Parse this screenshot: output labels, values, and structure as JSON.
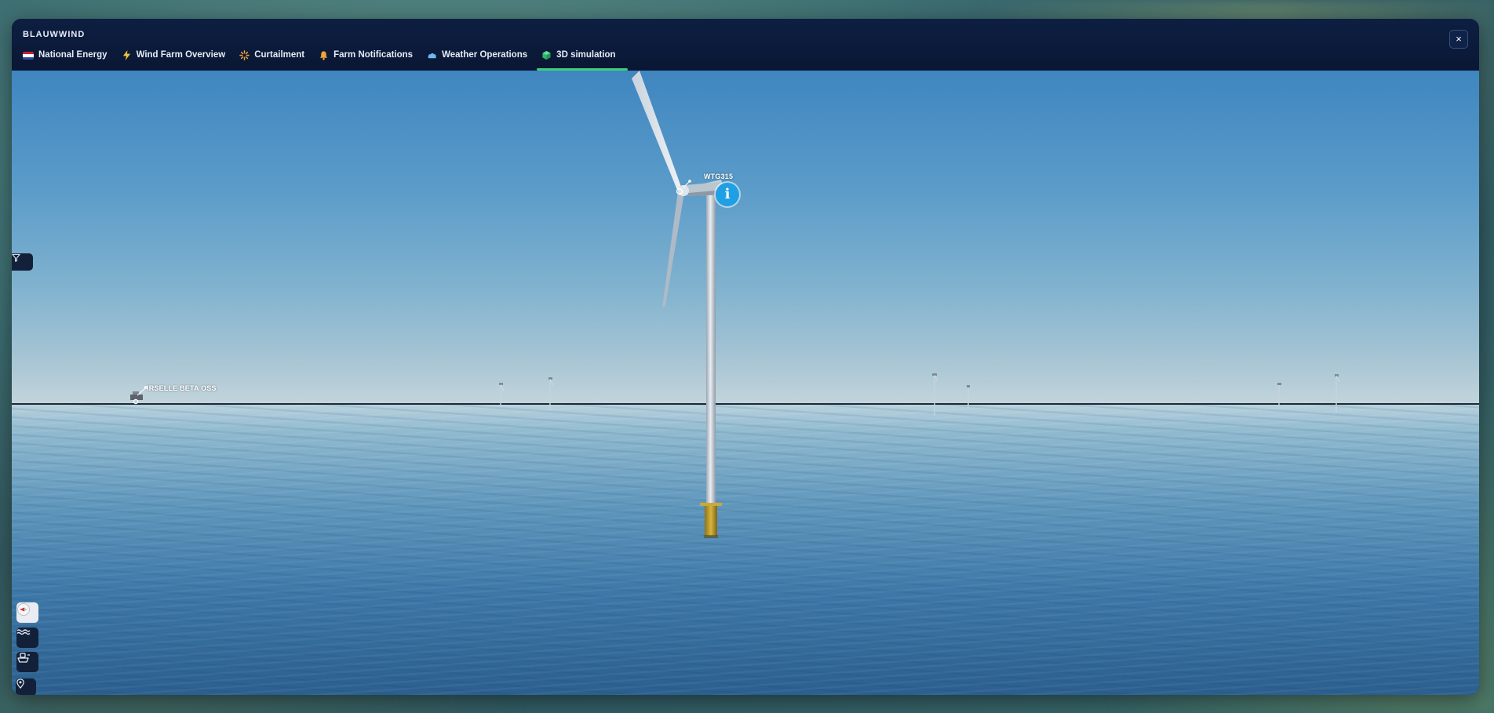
{
  "app": {
    "title": "BLAUWWIND",
    "close_label": "×"
  },
  "tabs": [
    {
      "label": "National Energy",
      "icon": "netherlands-flag-icon"
    },
    {
      "label": "Wind Farm Overview",
      "icon": "lightning-icon"
    },
    {
      "label": "Curtailment",
      "icon": "sun-burst-icon"
    },
    {
      "label": "Farm Notifications",
      "icon": "bell-icon"
    },
    {
      "label": "Weather Operations",
      "icon": "cloud-icon"
    },
    {
      "label": "3D simulation",
      "icon": "cube-icon",
      "active": true
    }
  ],
  "scene": {
    "turbine_label": "WTG315",
    "substation_label": "IRSELLE BETA OSS",
    "info_label": "i"
  },
  "toolbar": {
    "filter_icon": "filter-icon",
    "tools": [
      {
        "name": "compass-icon"
      },
      {
        "name": "waves-icon"
      },
      {
        "name": "boat-icon"
      },
      {
        "name": "location-pin-icon"
      }
    ]
  },
  "colors": {
    "header_bg": "#0d1f42",
    "active_tab_underline": "#3ad07a",
    "info_button": "#1f9fe4"
  }
}
